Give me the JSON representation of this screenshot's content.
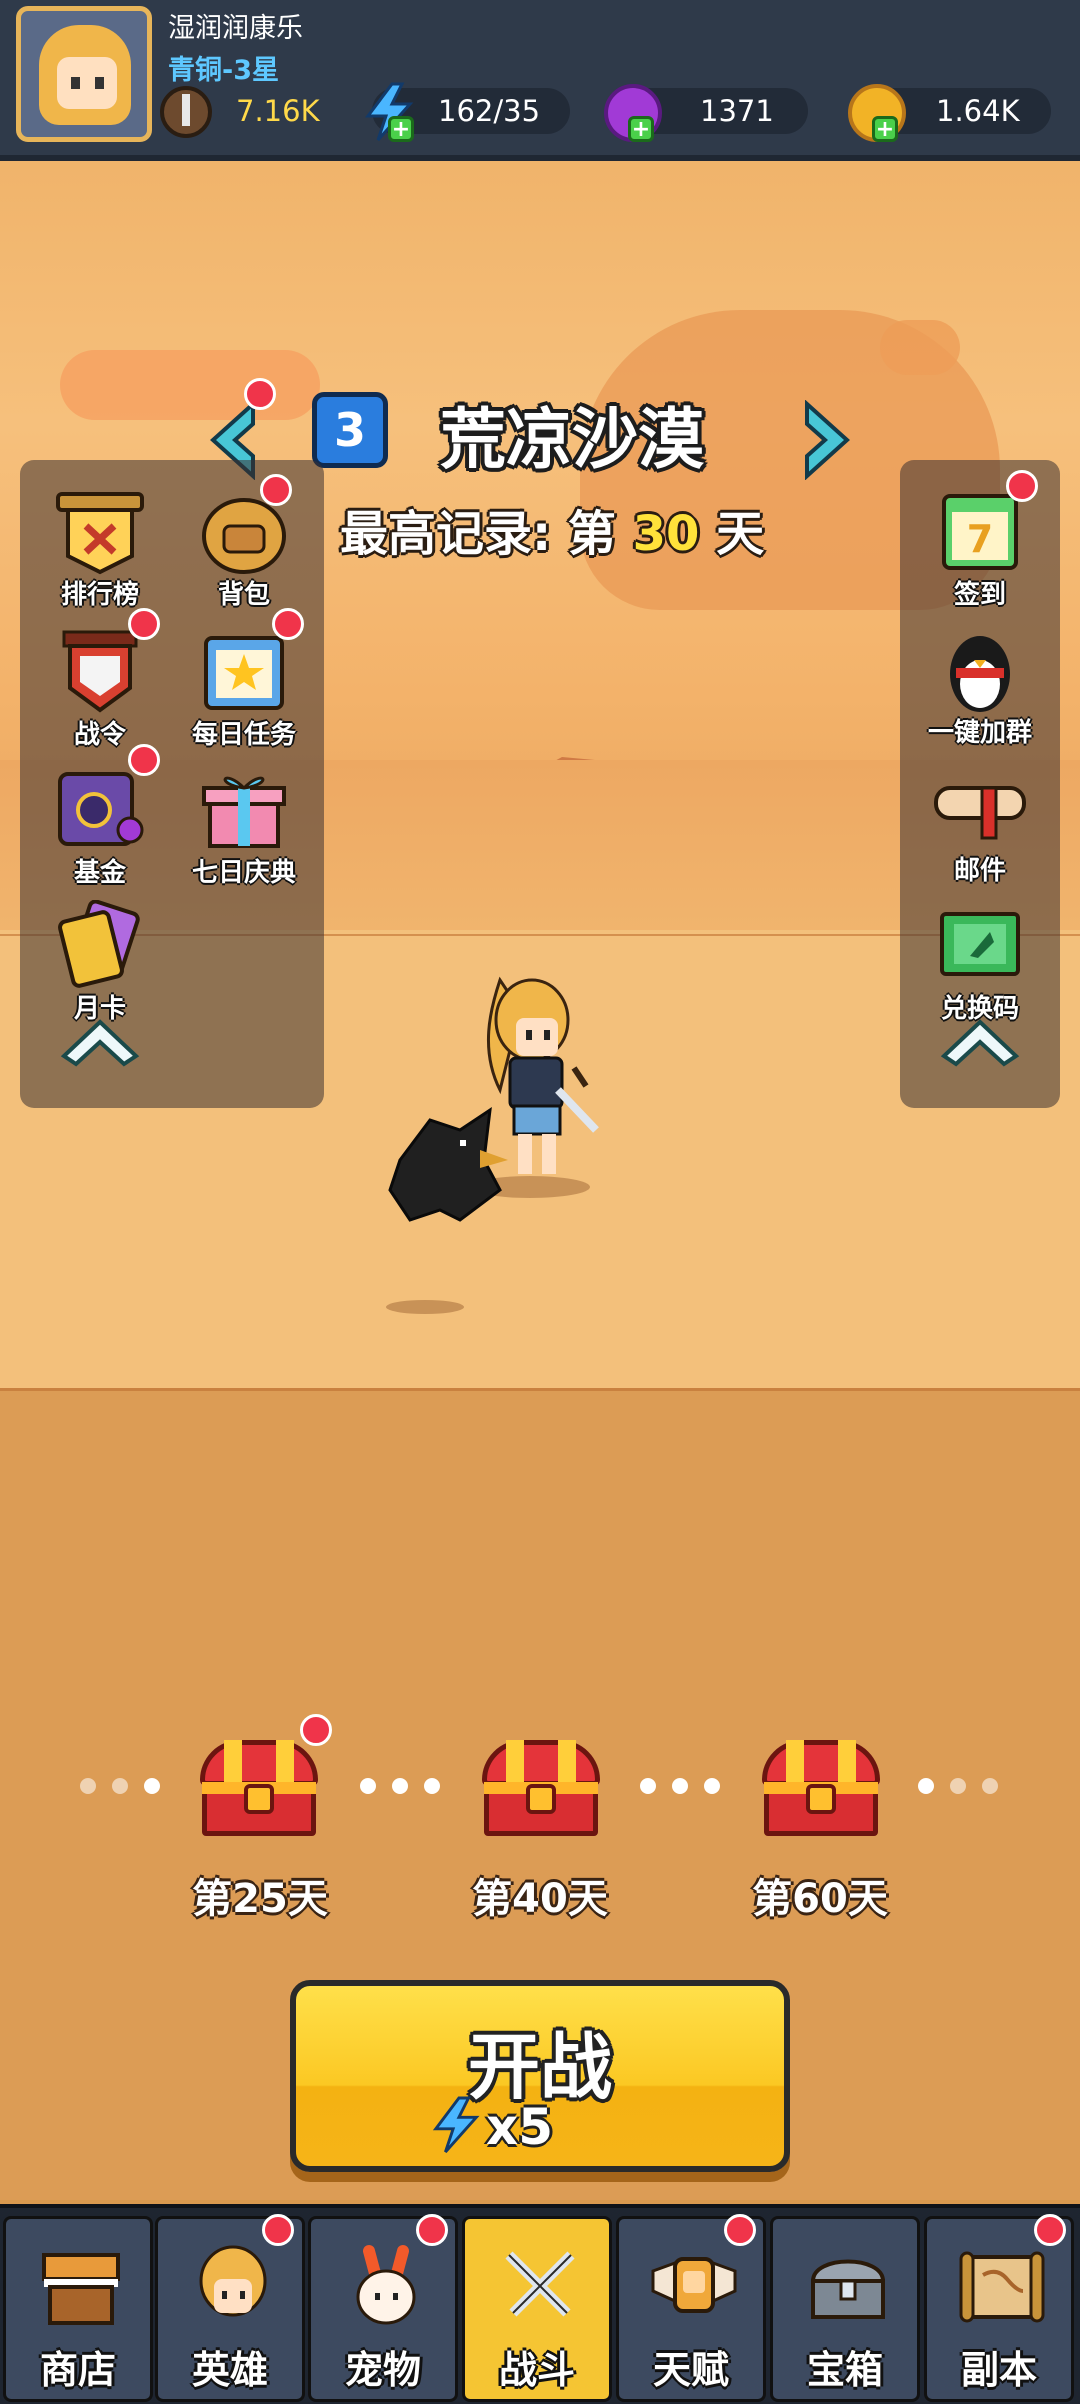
{
  "player": {
    "name": "湿润润康乐",
    "rank": "青铜-3星"
  },
  "resources": {
    "power": "7.16K",
    "energy": "162/35",
    "gems": "1371",
    "gold": "1.64K"
  },
  "stage": {
    "number": "3",
    "title": "荒凉沙漠",
    "record_prefix": "最高记录: 第",
    "record_day": "30",
    "record_suffix": "天"
  },
  "left_features": [
    {
      "label": "排行榜",
      "icon": "leaderboard-banner-icon",
      "badge": false
    },
    {
      "label": "背包",
      "icon": "backpack-icon",
      "badge": true
    },
    {
      "label": "战令",
      "icon": "battle-pass-shield-icon",
      "badge": true
    },
    {
      "label": "每日任务",
      "icon": "daily-task-board-icon",
      "badge": true
    },
    {
      "label": "基金",
      "icon": "fund-safe-icon",
      "badge": true
    },
    {
      "label": "七日庆典",
      "icon": "gift-box-icon",
      "badge": false
    },
    {
      "label": "月卡",
      "icon": "monthly-card-icon",
      "badge": false
    }
  ],
  "right_features": [
    {
      "label": "签到",
      "icon": "calendar-icon",
      "badge": true
    },
    {
      "label": "一键加群",
      "icon": "penguin-icon",
      "badge": false
    },
    {
      "label": "邮件",
      "icon": "mail-scroll-icon",
      "badge": false
    },
    {
      "label": "兑换码",
      "icon": "redeem-ticket-icon",
      "badge": false
    }
  ],
  "chests": [
    {
      "label": "第25天",
      "badge": true
    },
    {
      "label": "第40天",
      "badge": false
    },
    {
      "label": "第60天",
      "badge": false
    }
  ],
  "start": {
    "label": "开战",
    "cost": "x5"
  },
  "nav": [
    {
      "label": "商店",
      "icon": "shop-stall-icon",
      "badge": false,
      "active": false
    },
    {
      "label": "英雄",
      "icon": "hero-portrait-icon",
      "badge": true,
      "active": false
    },
    {
      "label": "宠物",
      "icon": "pet-bunny-icon",
      "badge": true,
      "active": false
    },
    {
      "label": "战斗",
      "icon": "crossed-swords-icon",
      "badge": false,
      "active": true
    },
    {
      "label": "天赋",
      "icon": "talent-fist-icon",
      "badge": true,
      "active": false
    },
    {
      "label": "宝箱",
      "icon": "treasure-chest-icon",
      "badge": false,
      "active": false
    },
    {
      "label": "副本",
      "icon": "dungeon-map-icon",
      "badge": true,
      "active": false
    }
  ],
  "colors": {
    "badge": "#f0344a",
    "accent_yellow": "#ffe23a",
    "rank_blue": "#5ec8ff"
  }
}
